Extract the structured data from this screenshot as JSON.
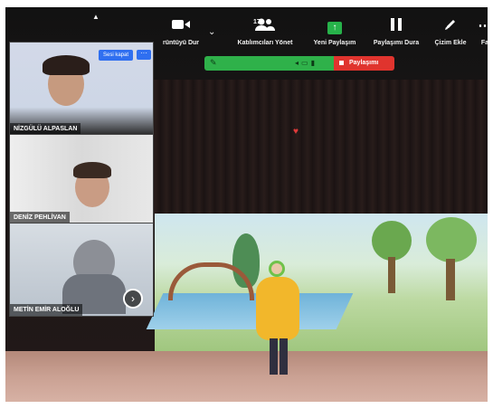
{
  "toolbar": {
    "items": [
      {
        "icon": "video-camera-icon",
        "label": "rüntüyü Dur"
      },
      {
        "icon": "participants-icon",
        "label": "Katılımcıları Yönet",
        "count": "17"
      },
      {
        "icon": "share-screen-icon",
        "label": "Yeni Paylaşım"
      },
      {
        "icon": "pause-icon",
        "label": "Paylaşımı Dura"
      },
      {
        "icon": "pencil-icon",
        "label": "Çizim Ekle"
      },
      {
        "icon": "more-icon",
        "label": "Fa"
      }
    ]
  },
  "share_bar": {
    "stop_label": "Paylaşımı"
  },
  "participants": [
    {
      "name": "NİZGÜLÜ ALPASLAN",
      "button": "Sesi kapat"
    },
    {
      "name": "DENİZ PEHLİVAN"
    },
    {
      "name": "METİN EMİR ALOĞLU"
    }
  ],
  "colors": {
    "share_green": "#2fb14a",
    "share_red": "#e0342e",
    "zoom_blue": "#2f6ff0"
  }
}
